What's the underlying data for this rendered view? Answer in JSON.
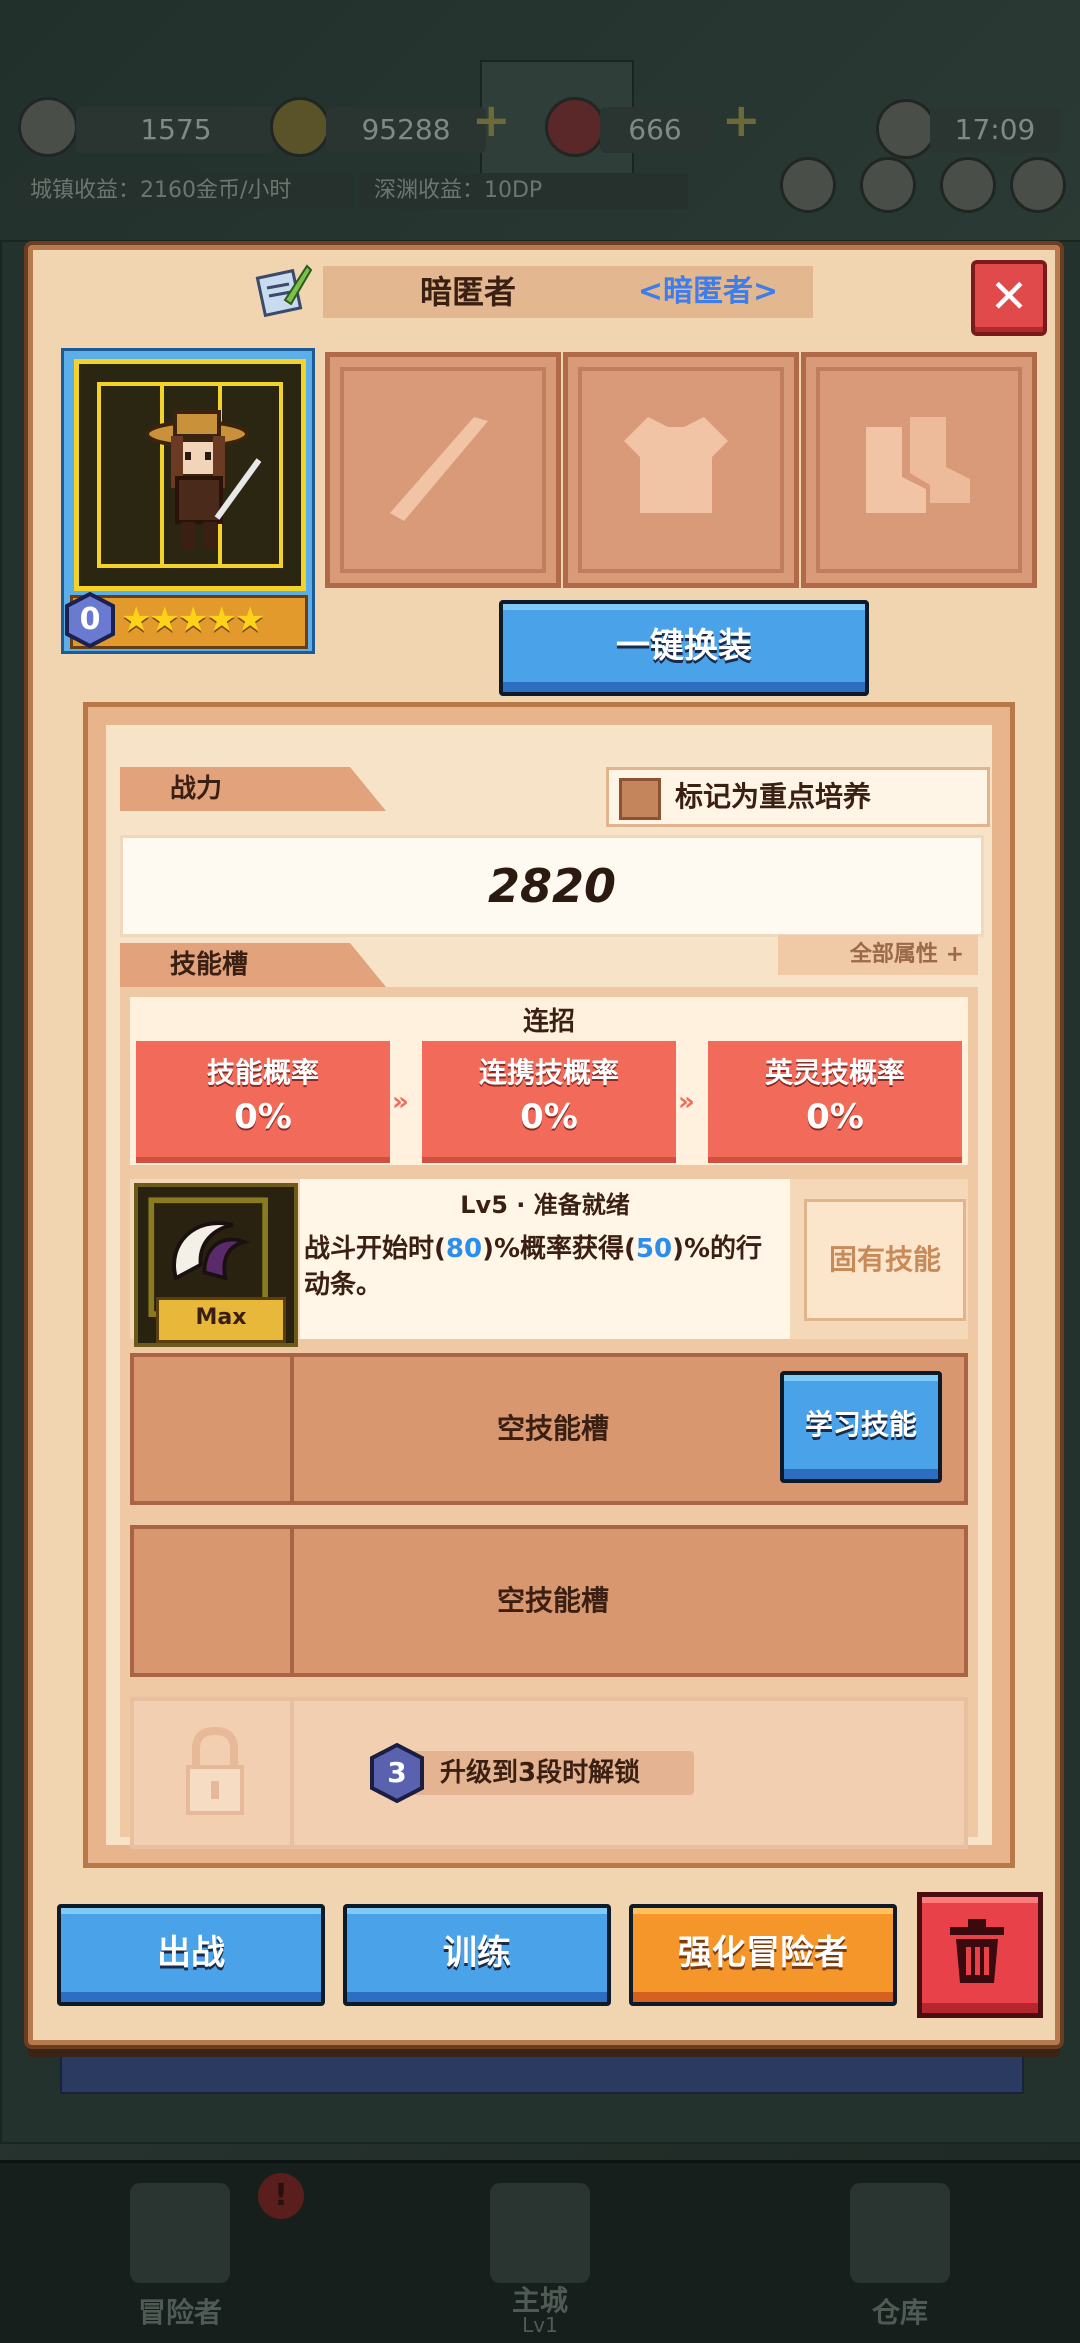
{
  "hud": {
    "resource1": "1575",
    "gold": "95288",
    "gems": "666",
    "time": "17:09",
    "town_income": "城镇收益：2160金币/小时",
    "abyss_income": "深渊收益：10DP"
  },
  "bottom_nav": {
    "adventurers": "冒险者",
    "main_city": "主城",
    "main_city_level": "Lv1",
    "warehouse": "仓库",
    "alert": "!"
  },
  "dialog": {
    "hero_name": "暗匿者",
    "hero_class": "<暗匿者>",
    "close": "✕",
    "rank": "0",
    "stars": "★★★★★",
    "one_click_equip": "一键换装",
    "mark_focus": "标记为重点培养",
    "power_label": "战力",
    "power_value": "2820",
    "all_attributes": "全部属性 +",
    "skill_slot_label": "技能槽",
    "combo_title": "连招",
    "rates": [
      {
        "name": "技能概率",
        "value": "0%"
      },
      {
        "name": "连携技概率",
        "value": "0%"
      },
      {
        "name": "英灵技概率",
        "value": "0%"
      }
    ],
    "skill": {
      "level_status": "Lv5 · 准备就绪",
      "desc_a": "战斗开始时(",
      "desc_v1": "80",
      "desc_b": ")%概率获得(",
      "desc_v2": "50",
      "desc_c": ")%的行动条。",
      "max_label": "Max",
      "innate": "固有技能"
    },
    "empty_slot_1": "空技能槽",
    "learn_skill": "学习技能",
    "empty_slot_2": "空技能槽",
    "unlock_rank": "3",
    "unlock_text": "升级到3段时解锁",
    "deploy": "出战",
    "train": "训练",
    "enhance": "强化冒险者"
  },
  "colors": {
    "panel_bg": "#f1d4b0",
    "accent_blue": "#4aa3e8",
    "accent_orange": "#f5962a",
    "rate_red": "#f26a5a",
    "close_red": "#e04a4a",
    "class_blue": "#3f7ee8"
  }
}
